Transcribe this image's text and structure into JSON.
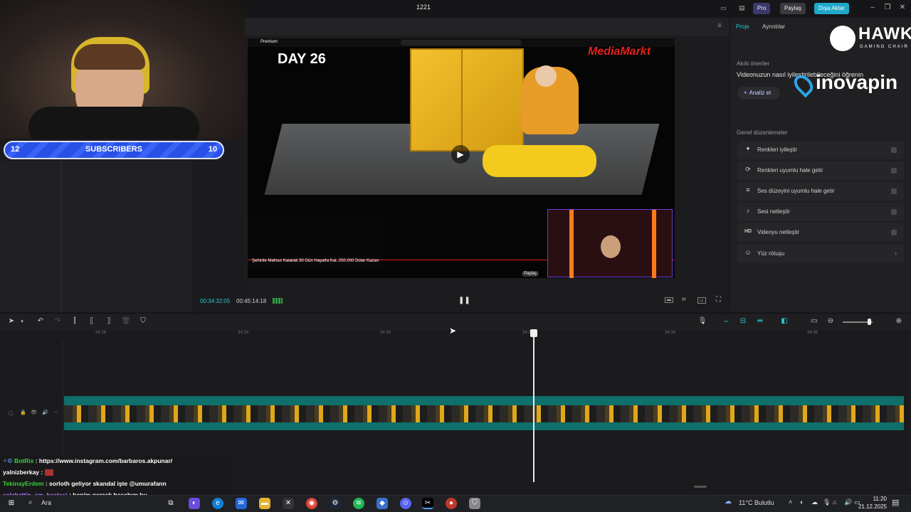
{
  "window": {
    "title": "1221",
    "pro_label": "Pro",
    "share_label": "Paylaş",
    "export_label": "Dışa Aktar"
  },
  "overlay": {
    "subscribers_left": "12",
    "subscribers_label": "SUBSCRIBERS",
    "subscribers_right": "10",
    "sponsor_brand": "HAWK",
    "sponsor_tagline": "GAMING CHAIR",
    "sponsor2": "inovapin"
  },
  "video": {
    "day_label": "DAY 26",
    "brand": "MediaMarkt",
    "yt_label": "Premium",
    "caption": "Şehirde Mahsur Kalarak 30 Gün Hayatta Kal, 250.000 Dolar Kazan",
    "share_label": "Paylaş"
  },
  "player": {
    "current_time": "00:34:32:05",
    "total_time": "00:45:14:18"
  },
  "right_panel": {
    "tabs": [
      "Proje",
      "Ayrıntılar"
    ],
    "smart_title": "Akıllı öneriler",
    "smart_text": "Videonuzun nasıl iyileştirilebileceğini öğrenin",
    "analyze_label": "Analiz et",
    "general_title": "Genel düzenlemeler",
    "items": [
      {
        "icon": "✦",
        "label": "Renkleri iyileştir"
      },
      {
        "icon": "⟳",
        "label": "Renkleri uyumlu hale getir"
      },
      {
        "icon": "≡",
        "label": "Ses düzeyini uyumlu hale getir"
      },
      {
        "icon": "♪",
        "label": "Sesi netleştir"
      },
      {
        "icon": "HD",
        "label": "Videoyu netleştir"
      },
      {
        "icon": "☺",
        "label": "Yüz rötuşu"
      }
    ]
  },
  "timeline": {
    "ticks": [
      "34:26",
      "34:28",
      "34:30",
      "34:32",
      "34:34",
      "34:36"
    ]
  },
  "chat": [
    {
      "user": "BotRix",
      "message": "https://www.instagram.com/barbaros.akpunar/",
      "color": "#3ad13a"
    },
    {
      "user": "yalnizberkay",
      "message": "",
      "color": "#ffffff"
    },
    {
      "user": "TekinayErdem",
      "message": "sorloth geliyor skandal işte @umurafann",
      "color": "#3ad13a"
    },
    {
      "user": "selahattin_am_hastasi",
      "message": "benim gerçek hesabım bu",
      "color": "#b47cff"
    }
  ],
  "taskbar": {
    "search_label": "Ara",
    "weather": "11°C Bulutlu",
    "time": "11:20",
    "date": "21.12.2025"
  }
}
